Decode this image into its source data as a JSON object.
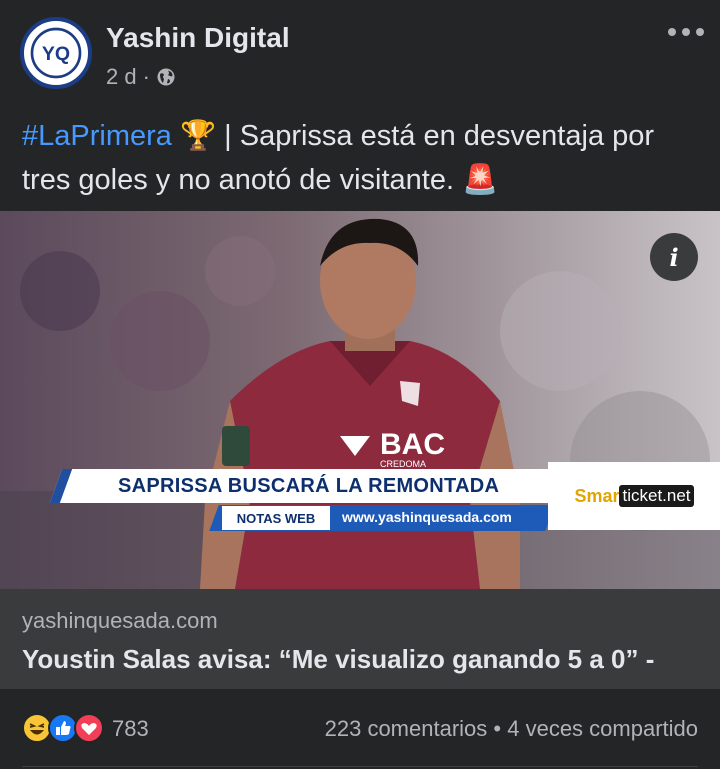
{
  "post": {
    "page_name": "Yashin Digital",
    "avatar_text": "YQ",
    "time": "2 d",
    "separator": "·",
    "privacy_icon": "globe-icon",
    "more_icon": "more-dots-icon",
    "hashtag": "#LaPrimera",
    "hashtag_emoji": "🏆",
    "text": " | Saprissa está en desventaja por tres goles y no anotó de visitante. ",
    "alert_emoji": "🚨"
  },
  "media": {
    "info_label": "i",
    "banner_title": "SAPRISSA BUSCARÁ LA REMONTADA",
    "notas_label": "NOTAS WEB",
    "url_overlay": "www.yashinquesada.com",
    "sponsor_prefix": "Smar",
    "sponsor_suffix": "ticket.net",
    "jersey_text": "BAC",
    "jersey_sub": "CREDOMA"
  },
  "link": {
    "domain": "yashinquesada.com",
    "headline": "Youstin Salas avisa: “Me visualizo ganando 5 a 0” -"
  },
  "engagement": {
    "reaction_icons": [
      "haha-icon",
      "like-icon",
      "love-icon"
    ],
    "reaction_count": "783",
    "comments": "223 comentarios",
    "dot": "•",
    "shares": "4 veces compartido"
  },
  "colors": {
    "background": "#242526",
    "link_card": "#3a3b3c",
    "hashtag": "#4599ff",
    "jersey": "#8e2a3e",
    "banner_blue": "#1e5bb8"
  }
}
